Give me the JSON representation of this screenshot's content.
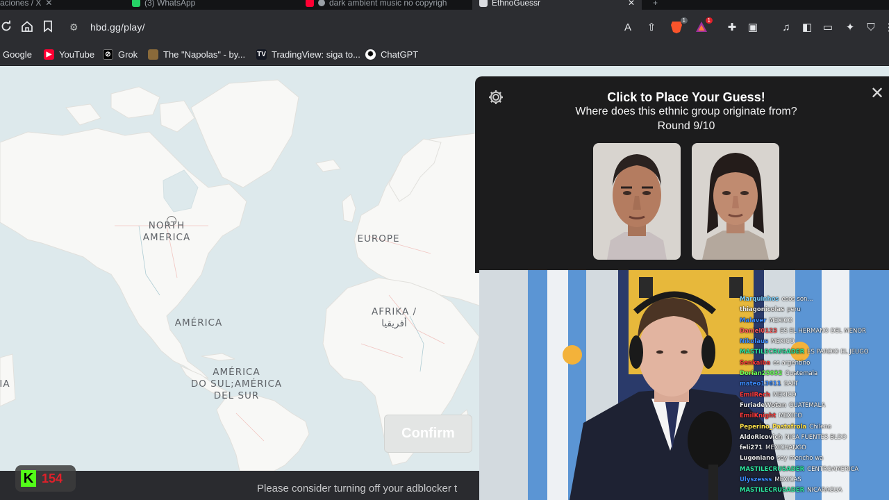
{
  "browser": {
    "tabs": [
      {
        "label": "aciones / X"
      },
      {
        "label": "(3) WhatsApp"
      },
      {
        "label": "dark ambient music no copyrigh"
      },
      {
        "label": "EthnoGuessr"
      }
    ],
    "url": "hbd.gg/play/",
    "bookmarks": [
      {
        "label": "Google"
      },
      {
        "label": "YouTube"
      },
      {
        "label": "Grok"
      },
      {
        "label": "The \"Napolas\" - by..."
      },
      {
        "label": "TradingView: siga to..."
      },
      {
        "label": "ChatGPT"
      }
    ],
    "extension_badges": {
      "brave": "1",
      "alert": "1"
    }
  },
  "map": {
    "labels": {
      "north_america": "NORTH\nAMERICA",
      "europe": "EUROPE",
      "africa": "AFRIKA /\nأفريقيا",
      "america": "AMÉRICA",
      "south_america": "AMÉRICA\nDO SUL;AMÉRICA\nDEL SUR",
      "asia_partial": "IA"
    },
    "confirm_label": "Confirm"
  },
  "panel": {
    "title": "Click to Place Your Guess!",
    "question": "Where does this ethnic group originate from?",
    "round": "Round 9/10"
  },
  "adblock_note": "Please consider turning off your adblocker t",
  "kick": {
    "count": "154",
    "accent": "#53fc18"
  },
  "chat": [
    {
      "user": "Marquinhos",
      "color": "#7fd3ff",
      "msg": "esos son..."
    },
    {
      "user": "thiagonicolas",
      "color": "#f0f0f0",
      "msg": "peru"
    },
    {
      "user": "Malaver",
      "color": "#3c8cff",
      "msg": "MEXICO"
    },
    {
      "user": "Daniel0123",
      "color": "#ff5a5a",
      "msg": "ES EL HERMANO DEL MENOR"
    },
    {
      "user": "Nikolaus",
      "color": "#3c8cff",
      "msg": "MEXICO"
    },
    {
      "user": "MASTILECRUSADER",
      "color": "#2ee6a0",
      "msg": "ES PARDIO EL JEUGO"
    },
    {
      "user": "Senkaiba",
      "color": "#ff3b3b",
      "msg": "es argentino"
    },
    {
      "user": "Dorian25032",
      "color": "#6cff5a",
      "msg": "Guatemala"
    },
    {
      "user": "mateo13611",
      "color": "#3c8cff",
      "msg": "SALT"
    },
    {
      "user": "EmilRech",
      "color": "#ff3b3b",
      "msg": "MEXICO"
    },
    {
      "user": "FuriadeWotan",
      "color": "#e8e8e8",
      "msg": "GUATEMALA"
    },
    {
      "user": "EmilKnight",
      "color": "#ff3b3b",
      "msg": "MEXICO"
    },
    {
      "user": "Peperino_Pastafrola",
      "color": "#ffe14a",
      "msg": "Chileno"
    },
    {
      "user": "AldoRicovich",
      "color": "#e8e8e8",
      "msg": "NICA FUENTES BLDO"
    },
    {
      "user": "feli271",
      "color": "#e8e8e8",
      "msg": "MEXICHANGO"
    },
    {
      "user": "Lugoniano",
      "color": "#e8e8e8",
      "msg": "soy mencho wa"
    },
    {
      "user": "MASTILECRUSADER",
      "color": "#2ee6a0",
      "msg": "CENTROAMERICA"
    },
    {
      "user": "Ulyszesss",
      "color": "#3c8cff",
      "msg": "MEXICAS"
    },
    {
      "user": "MASTILECRUSADER",
      "color": "#2ee6a0",
      "msg": "NICARAGUA"
    }
  ]
}
